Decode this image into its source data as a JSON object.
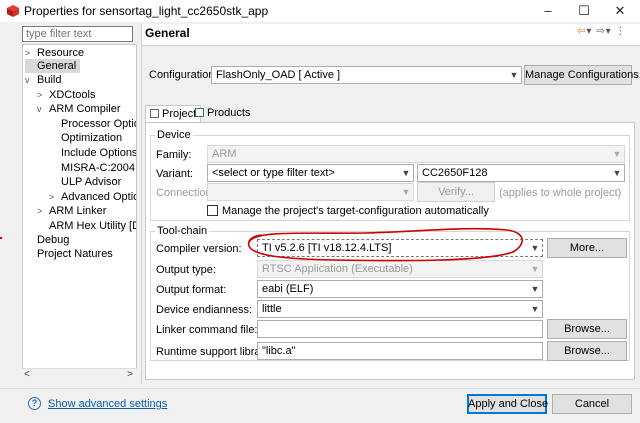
{
  "window": {
    "title": "Properties for sensortag_light_cc2650stk_app",
    "icon": "red-cube-icon",
    "controls": {
      "minimize": "–",
      "maximize": "☐",
      "close": "✕"
    }
  },
  "sidebar": {
    "filter_placeholder": "type filter text",
    "items": [
      {
        "label": "Resource",
        "level": 0,
        "arrow": ">"
      },
      {
        "label": "General",
        "level": 0,
        "arrow": "",
        "selected": true
      },
      {
        "label": "Build",
        "level": 0,
        "arrow": "v"
      },
      {
        "label": "XDCtools",
        "level": 1,
        "arrow": ">"
      },
      {
        "label": "ARM Compiler",
        "level": 1,
        "arrow": "v"
      },
      {
        "label": "Processor Option",
        "level": 2,
        "arrow": ""
      },
      {
        "label": "Optimization",
        "level": 2,
        "arrow": ""
      },
      {
        "label": "Include Options",
        "level": 2,
        "arrow": ""
      },
      {
        "label": "MISRA-C:2004",
        "level": 2,
        "arrow": ""
      },
      {
        "label": "ULP Advisor",
        "level": 2,
        "arrow": ""
      },
      {
        "label": "Advanced Option",
        "level": 2,
        "arrow": ">"
      },
      {
        "label": "ARM Linker",
        "level": 1,
        "arrow": ">"
      },
      {
        "label": "ARM Hex Utility  [Dis",
        "level": 1,
        "arrow": ""
      },
      {
        "label": "Debug",
        "level": 0,
        "arrow": ""
      },
      {
        "label": "Project Natures",
        "level": 0,
        "arrow": ""
      }
    ],
    "scroll_left": "<",
    "scroll_right": ">"
  },
  "header": {
    "title": "General",
    "nav_back": "⇦",
    "nav_forward": "⇨",
    "nav_dropdown": "▾",
    "nav_menu": "⋮"
  },
  "configuration": {
    "label": "Configuration:",
    "value": "FlashOnly_OAD  [ Active ]",
    "manage_button": "Manage Configurations..."
  },
  "tabs": [
    {
      "label": "Project",
      "active": true
    },
    {
      "label": "Products",
      "active": false
    }
  ],
  "device": {
    "group_title": "Device",
    "family_label": "Family:",
    "family_value": "ARM",
    "variant_label": "Variant:",
    "variant_filter": "<select or type filter text>",
    "variant_value": "CC2650F128",
    "connection_label": "Connection:",
    "connection_value": "",
    "verify_button": "Verify...",
    "verify_note": "(applies to whole project)",
    "manage_checkbox_label": "Manage the project's target-configuration automatically",
    "manage_checkbox_checked": false
  },
  "toolchain": {
    "group_title": "Tool-chain",
    "compiler_label": "Compiler version:",
    "compiler_value": "TI v5.2.6  [TI v18.12.4.LTS]",
    "more_button": "More...",
    "output_type_label": "Output type:",
    "output_type_value": "RTSC Application (Executable)",
    "output_format_label": "Output format:",
    "output_format_value": "eabi (ELF)",
    "endianness_label": "Device endianness:",
    "endianness_value": "little",
    "linker_cmd_label": "Linker command file:",
    "linker_cmd_value": "",
    "runtime_label": "Runtime support library:",
    "runtime_value": "\"libc.a\"",
    "browse_label": "Browse..."
  },
  "footer": {
    "help_icon": "?",
    "advanced_link": "Show advanced settings",
    "apply_close": "Apply and Close",
    "cancel": "Cancel"
  },
  "colors": {
    "annotation_red": "#cc0000",
    "link_blue": "#0b5cad",
    "primary_border": "#0078d7"
  }
}
